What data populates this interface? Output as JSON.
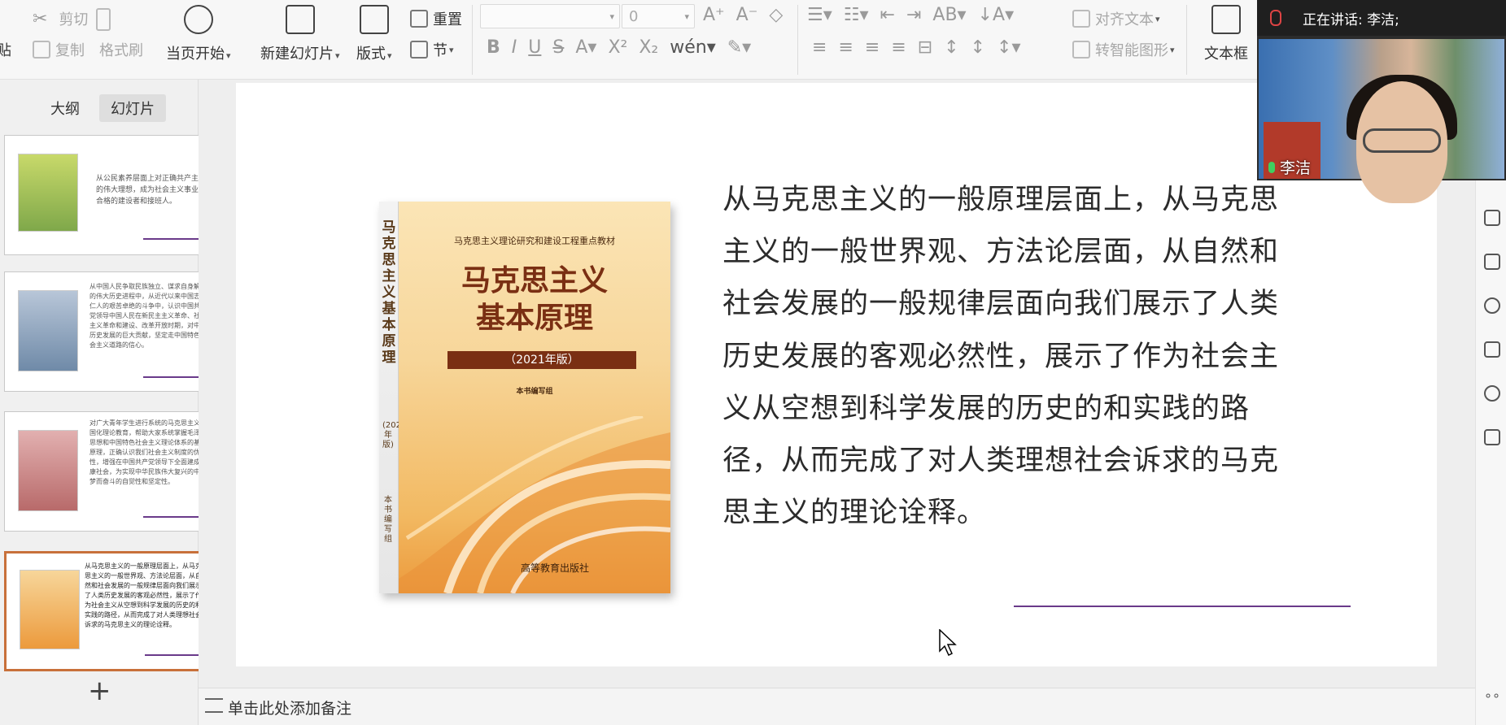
{
  "toolbar": {
    "cut": "剪切",
    "copy": "复制",
    "paste_partial": "贴",
    "format_painter": "格式刷",
    "play_current": "当页开始",
    "new_slide": "新建幻灯片",
    "layout": "版式",
    "reset": "重置",
    "section": "节",
    "font_size_value": "0",
    "align_text": "对齐文本",
    "smart_art": "转智能图形",
    "textbox": "文本框"
  },
  "left_panel": {
    "tab_outline": "大纲",
    "tab_slides": "幻灯片",
    "add_slide": "+",
    "thumbnails": [
      {
        "text": "从公民素养层面上对正确共产主义的伟大理想，成为社会主义事业的合格的建设者和接班人。"
      },
      {
        "text": "从中国人民争取民族独立、谋求自身解放的伟大历史进程中，从近代以来中国志士仁人的艰苦卓绝的斗争中，认识中国共产党领导中国人民在新民主主义革命、社会主义革命和建设、改革开放时期，对中国历史发展的巨大贡献，坚定走中国特色社会主义道路的信心。"
      },
      {
        "text": "对广大青年学生进行系统的马克思主义中国化理论教育，帮助大家系统掌握毛泽东思想和中国特色社会主义理论体系的基本原理，正确认识我们社会主义制度的优越性，增强在中国共产党领导下全面建成小康社会，为实现中华民族伟大复兴的中国梦而奋斗的自觉性和坚定性。"
      },
      {
        "text": "从马克思主义的一般原理层面上，从马克思主义的一般世界观、方法论层面，从自然和社会发展的一般规律层面向我们展示了人类历史发展的客观必然性，展示了作为社会主义从空想到科学发展的历史的和实践的路径，从而完成了对人类理想社会诉求的马克思主义的理论诠释。"
      }
    ]
  },
  "slide": {
    "book_series": "马克思主义理论研究和建设工程重点教材",
    "book_title_line1": "马克思主义",
    "book_title_line2": "基本原理",
    "book_edition": "（2021年版）",
    "book_editors": "本书编写组",
    "book_spine_title": "马克思主义基本原理",
    "book_spine_edition": "(2021年版)",
    "book_spine_editors": "本书编写组",
    "book_press": "高等教育出版社",
    "body_text": "从马克思主义的一般原理层面上，从马克思主义的一般世界观、方法论层面，从自然和社会发展的一般规律层面向我们展示了人类历史发展的客观必然性，展示了作为社会主义从空想到科学发展的历史的和实践的路径，从而完成了对人类理想社会诉求的马克思主义的理论诠释。"
  },
  "notes": {
    "placeholder": "单击此处添加备注"
  },
  "video": {
    "speaking_label": "正在讲话: 李洁;",
    "participant_name": "李洁"
  }
}
